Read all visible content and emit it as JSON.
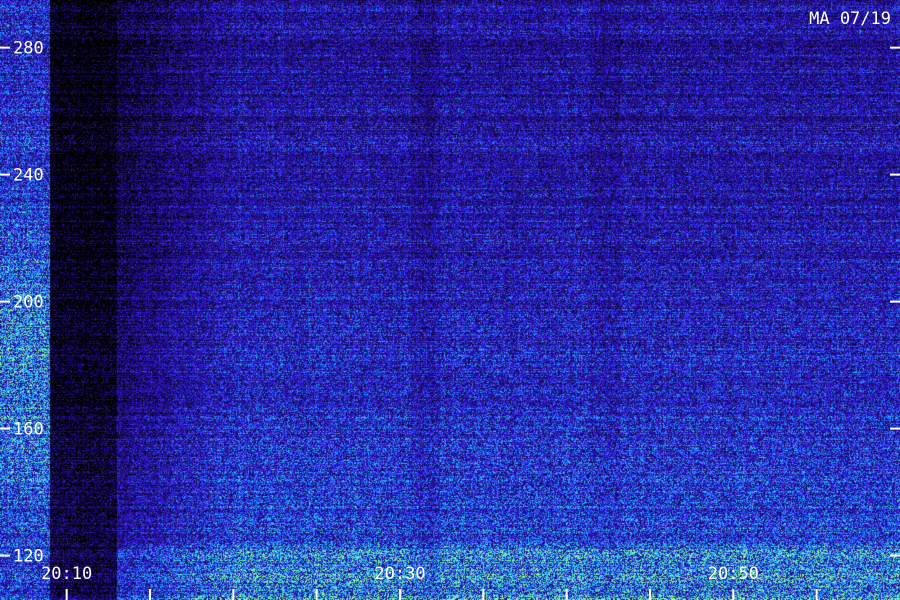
{
  "chart_data": {
    "type": "heatmap",
    "title": "MA 07/19",
    "y_axis": {
      "ticks": [
        {
          "value": 280,
          "label": "280"
        },
        {
          "value": 240,
          "label": "240"
        },
        {
          "value": 200,
          "label": "200"
        },
        {
          "value": 160,
          "label": "160"
        },
        {
          "value": 120,
          "label": "120"
        }
      ],
      "range": [
        106,
        295
      ]
    },
    "x_axis": {
      "ticks": [
        {
          "value": "20:10",
          "label": "20:10"
        },
        {
          "value": "20:30",
          "label": "20:30"
        },
        {
          "value": "20:50",
          "label": "20:50"
        }
      ],
      "range": [
        "20:06",
        "21:00"
      ],
      "minor_tick_interval_minutes": 5
    },
    "grid": false,
    "colors": {
      "background": "#000000",
      "low": "#05021a",
      "mid": "#3a1cf0",
      "high": "#1ec8ff",
      "peak": "#9cff8a",
      "text": "#ffffff"
    },
    "features": [
      {
        "description": "bright wideband band before data gap",
        "start": "20:06",
        "end": "20:09"
      },
      {
        "description": "data gap",
        "start": "20:09",
        "end": "20:13"
      }
    ]
  }
}
